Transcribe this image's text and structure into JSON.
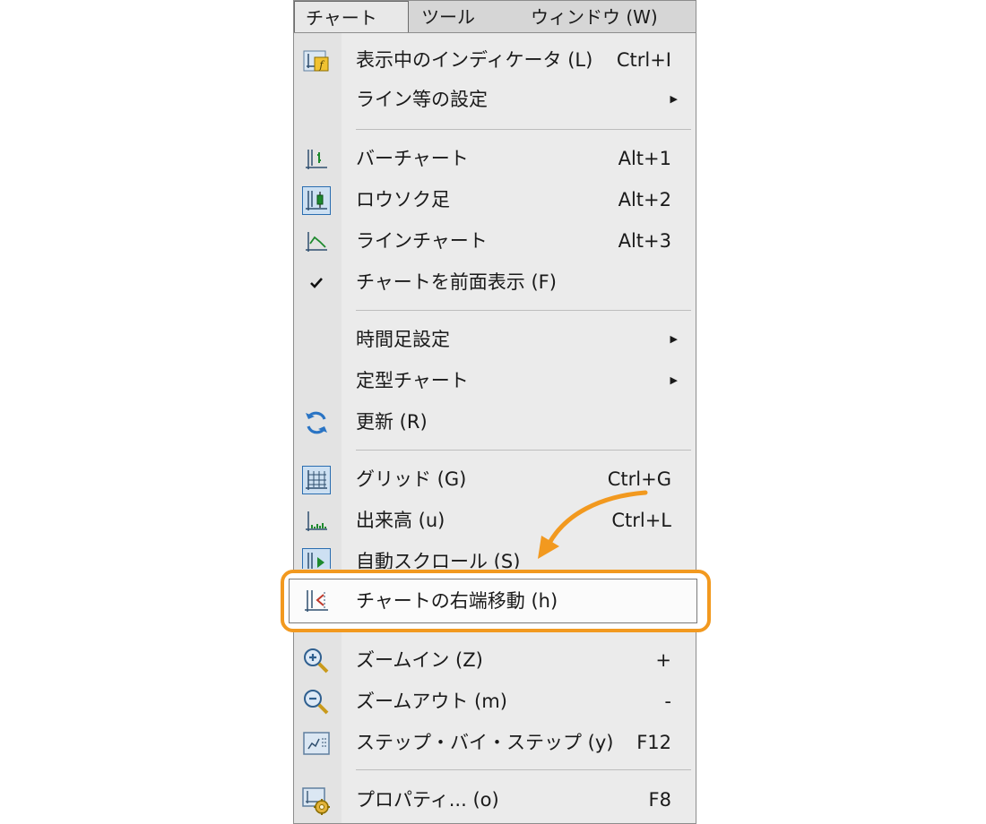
{
  "menubar": {
    "items": [
      {
        "label": "チャート (C)"
      },
      {
        "label": "ツール (T)"
      },
      {
        "label": "ウィンドウ (W)"
      }
    ]
  },
  "menu": {
    "items": [
      {
        "label": "表示中のインディケータ (L)",
        "shortcut": "Ctrl+I",
        "icon": "indicator-list-icon"
      },
      {
        "label": "ライン等の設定",
        "submenu": true
      },
      {
        "label": "バーチャート",
        "shortcut": "Alt+1",
        "icon": "bar-chart-icon"
      },
      {
        "label": "ロウソク足",
        "shortcut": "Alt+2",
        "icon": "candlestick-icon",
        "selected": true
      },
      {
        "label": "ラインチャート",
        "shortcut": "Alt+3",
        "icon": "line-chart-icon"
      },
      {
        "label": "チャートを前面表示 (F)",
        "icon": "checkmark-icon",
        "checked": true
      },
      {
        "label": "時間足設定",
        "submenu": true
      },
      {
        "label": "定型チャート",
        "submenu": true
      },
      {
        "label": "更新 (R)",
        "icon": "refresh-icon"
      },
      {
        "label": "グリッド (G)",
        "shortcut": "Ctrl+G",
        "icon": "grid-icon",
        "selected": true
      },
      {
        "label": "出来高 (u)",
        "shortcut": "Ctrl+L",
        "icon": "volume-icon"
      },
      {
        "label": "自動スクロール (S)",
        "icon": "auto-scroll-icon",
        "selected": true
      },
      {
        "label": "チャートの右端移動 (h)",
        "icon": "chart-shift-icon",
        "highlighted": true
      },
      {
        "label": "ズームイン (Z)",
        "shortcut": "+",
        "icon": "zoom-in-icon"
      },
      {
        "label": "ズームアウト (m)",
        "shortcut": "-",
        "icon": "zoom-out-icon"
      },
      {
        "label": "ステップ・バイ・ステップ (y)",
        "shortcut": "F12",
        "icon": "step-by-step-icon"
      },
      {
        "label": "プロパティ... (o)",
        "shortcut": "F8",
        "icon": "properties-icon"
      }
    ]
  },
  "colors": {
    "callout": "#f2991f",
    "selection_border": "#2a6db0",
    "selection_fill": "#cde0f2"
  }
}
